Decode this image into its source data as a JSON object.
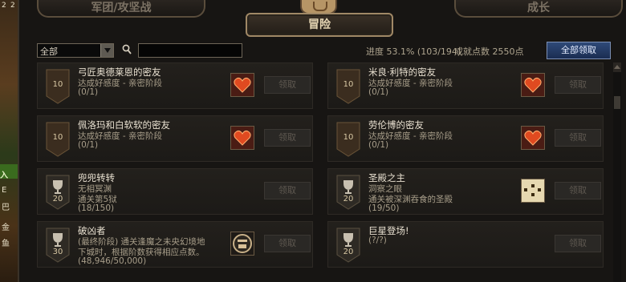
{
  "game_strip": {
    "top_num": "2",
    "left_marker": "·",
    "green_label": "入",
    "side_texts": [
      "E",
      "巴",
      "金",
      "鱼"
    ]
  },
  "tabs": {
    "corps": "军团/攻坚战",
    "adventure": "冒险",
    "growth": "成长"
  },
  "toolbar": {
    "filter_value": "全部",
    "search_placeholder": "",
    "progress": "进度 53.1% (103/194)",
    "points": "成就点数 2550点",
    "claim_all": "全部领取"
  },
  "claim_label": "领取",
  "achievements": [
    {
      "badge": "10",
      "badge_type": "shield",
      "title": "弓匠奥德莱恩的密友",
      "lines": [
        "达成好感度 - 亲密阶段",
        "(0/1)"
      ],
      "reward_icon": "heart-icon"
    },
    {
      "badge": "10",
      "badge_type": "shield",
      "title": "米良·利特的密友",
      "lines": [
        "达成好感度 - 亲密阶段",
        "(0/1)"
      ],
      "reward_icon": "heart-icon"
    },
    {
      "badge": "10",
      "badge_type": "shield",
      "title": "佩洛玛和白软软的密友",
      "lines": [
        "达成好感度 - 亲密阶段",
        "(0/1)"
      ],
      "reward_icon": "heart-icon"
    },
    {
      "badge": "10",
      "badge_type": "shield",
      "title": "劳伦博的密友",
      "lines": [
        "达成好感度 - 亲密阶段",
        "(0/1)"
      ],
      "reward_icon": "heart-icon"
    },
    {
      "badge": "20",
      "badge_type": "cup",
      "title": "兜兜转转",
      "lines": [
        "无相冥渊",
        "通关第5狱",
        "(18/150)"
      ],
      "reward_icon": ""
    },
    {
      "badge": "20",
      "badge_type": "cup",
      "title": "圣殿之主",
      "lines": [
        "洞察之眼",
        "通关被深渊吞食的圣殿",
        "(19/50)"
      ],
      "reward_icon": "scroll-icon"
    },
    {
      "badge": "30",
      "badge_type": "cup",
      "title": "破凶者",
      "lines": [
        "(最终阶段) 通关逢魔之未央幻境地",
        "下城时，根据阶数获得相应点数。",
        "(48,946/50,000)"
      ],
      "reward_icon": "emblem-icon"
    },
    {
      "badge": "20",
      "badge_type": "cup",
      "title": "巨星登场!",
      "lines": [
        "(?/?)"
      ],
      "reward_icon": ""
    }
  ]
}
